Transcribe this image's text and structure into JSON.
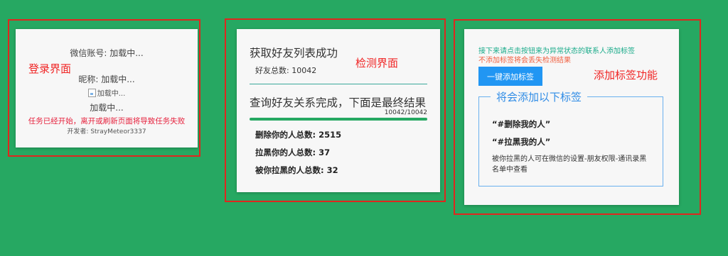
{
  "login_panel": {
    "account_line": "微信账号: 加载中...",
    "nickname_line": "昵称: 加载中...",
    "avatar_alt": "加载中...",
    "loading_text": "加载中...",
    "warning": "任务已经开始，离开或刷新页面将导致任务失败",
    "developer": "开发者: StrayMeteor3337"
  },
  "detect_panel": {
    "title_fetch": "获取好友列表成功",
    "friend_total": "好友总数: 10042",
    "title_query": "查询好友关系完成，下面是最终结果",
    "progress_text": "10042/10042",
    "progress_fraction": 1.0,
    "deleted_count": "删除你的人总数: 2515",
    "blocked_you_count": "拉黑你的人总数: 37",
    "blocked_by_you_count": "被你拉黑的人总数: 32"
  },
  "tag_panel": {
    "instruction": "接下来请点击按钮来为异常状态的联系人添加标签",
    "warning": "不添加标签将会丢失检测结果",
    "button_label": "一键添加标签",
    "legend": "将会添加以下标签",
    "tags": [
      "“#删除我的人”",
      "“#拉黑我的人”"
    ],
    "note": "被你拉黑的人可在微信的设置-朋友权限-通讯录黑名单中查看"
  },
  "annotations": {
    "login": "登录界面",
    "detect": "检测界面",
    "tag": "添加标签功能"
  },
  "colors": {
    "background": "#26a862",
    "frame": "#e0261e",
    "button": "#2196f3",
    "progress": "#26a862"
  }
}
